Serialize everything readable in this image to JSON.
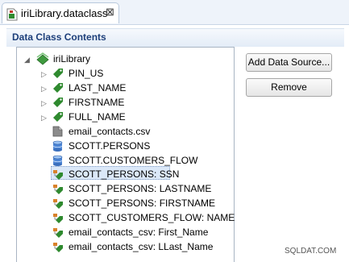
{
  "tab": {
    "title": "iriLibrary.dataclass",
    "close_glyph": "⊠",
    "icon": "dataclass-icon"
  },
  "section": {
    "title": "Data Class Contents"
  },
  "tree": {
    "root": {
      "label": "iriLibrary",
      "expanded": true
    },
    "items": [
      {
        "label": "PIN_US",
        "icon": "green-tag-icon",
        "has_arrow": true
      },
      {
        "label": "LAST_NAME",
        "icon": "green-tag-icon",
        "has_arrow": true
      },
      {
        "label": "FIRSTNAME",
        "icon": "green-tag-icon",
        "has_arrow": true
      },
      {
        "label": "FULL_NAME",
        "icon": "green-tag-icon",
        "has_arrow": true
      },
      {
        "label": "email_contacts.csv",
        "icon": "file-icon",
        "has_arrow": false
      },
      {
        "label": "SCOTT.PERSONS",
        "icon": "database-icon",
        "has_arrow": false
      },
      {
        "label": "SCOTT.CUSTOMERS_FLOW",
        "icon": "database-icon",
        "has_arrow": false
      },
      {
        "label": "SCOTT_PERSONS: SSN",
        "icon": "column-map-icon",
        "has_arrow": false,
        "selected": true
      },
      {
        "label": "SCOTT_PERSONS: LASTNAME",
        "icon": "column-map-icon",
        "has_arrow": false
      },
      {
        "label": "SCOTT_PERSONS: FIRSTNAME",
        "icon": "column-map-icon",
        "has_arrow": false
      },
      {
        "label": "SCOTT_CUSTOMERS_FLOW: NAME",
        "icon": "column-map-icon",
        "has_arrow": false
      },
      {
        "label": "email_contacts_csv: First_Name",
        "icon": "column-map-icon",
        "has_arrow": false
      },
      {
        "label": "email_contacts_csv: LLast_Name",
        "icon": "column-map-icon",
        "has_arrow": false
      }
    ]
  },
  "buttons": {
    "add_data_source": "Add Data Source...",
    "remove": "Remove"
  },
  "watermark": "SQLDAT.COM",
  "colors": {
    "tag_green": "#2f8a2f",
    "db_blue": "#4d86d6",
    "section_title": "#1d3f7a",
    "selection": "#dbe8f8"
  }
}
